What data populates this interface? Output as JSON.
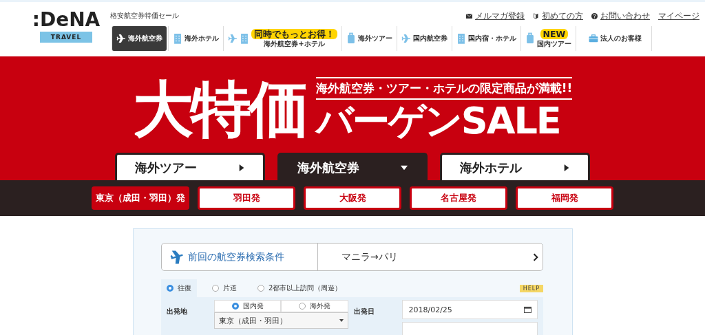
{
  "header": {
    "logo": {
      "wordmark": ":DeNA",
      "sub": "TRAVEL"
    },
    "tagline": "格安航空券特価セール",
    "top_links": [
      {
        "label": "メルマガ登録"
      },
      {
        "label": "初めての方"
      },
      {
        "label": "お問い合わせ"
      },
      {
        "label": "マイページ"
      }
    ],
    "nav": [
      {
        "label": "海外航空券",
        "selected": true
      },
      {
        "label": "海外ホテル",
        "selected": false
      },
      {
        "label": "海外航空券+ホテル",
        "badge": "同時でもっとお得！",
        "selected": false
      },
      {
        "label": "海外ツアー",
        "selected": false
      },
      {
        "label": "国内航空券",
        "selected": false
      },
      {
        "label": "国内宿・ホテル",
        "selected": false
      },
      {
        "label": "国内ツアー",
        "badge": "NEW",
        "selected": false
      },
      {
        "label": "法人のお客様",
        "selected": false
      }
    ]
  },
  "banner": {
    "headline": "大特価",
    "subhead": "海外航空券・ツアー・ホテルの限定商品が満載!!",
    "title": "バーゲンSALE"
  },
  "product_tabs": [
    {
      "label": "海外ツアー",
      "selected": false
    },
    {
      "label": "海外航空券",
      "selected": true
    },
    {
      "label": "海外ホテル",
      "selected": false
    }
  ],
  "origin_buttons": [
    {
      "label": "東京（成田・羽田）発",
      "selected": true
    },
    {
      "label": "羽田発",
      "selected": false
    },
    {
      "label": "大阪発",
      "selected": false
    },
    {
      "label": "名古屋発",
      "selected": false
    },
    {
      "label": "福岡発",
      "selected": false
    }
  ],
  "search": {
    "previous": {
      "label": "前回の航空券検索条件",
      "value": "マニラ→パリ"
    },
    "trip_types": [
      {
        "label": "往復",
        "selected": true
      },
      {
        "label": "片道",
        "selected": false
      },
      {
        "label": "2都市以上訪問（周遊）",
        "selected": false
      }
    ],
    "help": "HELP",
    "departure": {
      "label": "出発地",
      "options": [
        {
          "label": "国内発",
          "selected": true
        },
        {
          "label": "海外発",
          "selected": false
        }
      ],
      "value": "東京（成田・羽田）"
    },
    "date": {
      "label": "出発日",
      "value": "2018/02/25"
    }
  }
}
